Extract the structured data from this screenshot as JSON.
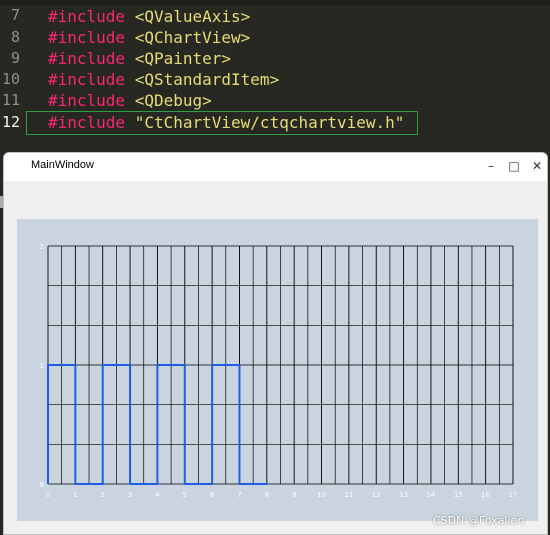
{
  "editor": {
    "lines": [
      {
        "number": "7",
        "keyword": "#include",
        "path": "<QValueAxis>"
      },
      {
        "number": "8",
        "keyword": "#include",
        "path": "<QChartView>"
      },
      {
        "number": "9",
        "keyword": "#include",
        "path": "<QPainter>"
      },
      {
        "number": "10",
        "keyword": "#include",
        "path": "<QStandardItem>"
      },
      {
        "number": "11",
        "keyword": "#include",
        "path": "<QDebug>"
      },
      {
        "number": "12",
        "keyword": "#include",
        "path": "\"CtChartView/ctqchartview.h\""
      }
    ]
  },
  "window": {
    "title": "MainWindow",
    "minimize_glyph": "–",
    "maximize_glyph": "□",
    "close_glyph": "✕"
  },
  "chart_data": {
    "type": "line",
    "title": "",
    "xlabel": "",
    "ylabel": "",
    "xlim": [
      0,
      17
    ],
    "ylim": [
      0,
      2
    ],
    "x_ticks": [
      "0",
      "1",
      "2",
      "3",
      "4",
      "5",
      "6",
      "7",
      "8",
      "9",
      "10",
      "11",
      "12",
      "13",
      "14",
      "15",
      "16",
      "17"
    ],
    "y_ticks": [
      "0",
      "1",
      "2"
    ],
    "grid": true,
    "series": [
      {
        "color": "#1f5fe8",
        "step": true,
        "x": [
          0,
          1,
          2,
          3,
          4,
          5,
          6,
          7,
          8
        ],
        "y": [
          1,
          0,
          1,
          0,
          1,
          0,
          1,
          0,
          0
        ]
      }
    ]
  },
  "watermark": "CSDN @Foxalien"
}
